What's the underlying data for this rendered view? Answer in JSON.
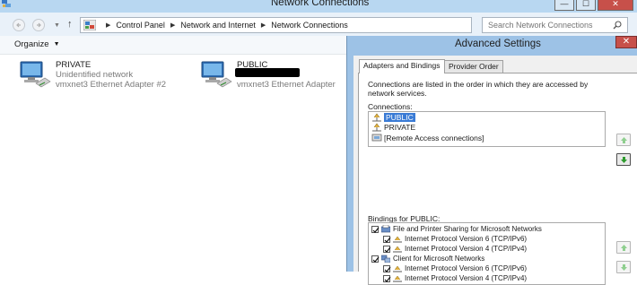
{
  "window": {
    "title": "Network Connections",
    "buttons": {
      "minimize": "—",
      "maximize": "☐",
      "close": "✕"
    }
  },
  "address": {
    "crumbs": [
      "Control Panel",
      "Network and Internet",
      "Network Connections"
    ],
    "search_placeholder": "Search Network Connections"
  },
  "toolbar": {
    "organize_label": "Organize"
  },
  "adapters": [
    {
      "name": "PRIVATE",
      "status": "Unidentified network",
      "device": "vmxnet3 Ethernet Adapter #2"
    },
    {
      "name": "PUBLIC",
      "status": "…",
      "device": "vmxnet3 Ethernet Adapter"
    }
  ],
  "dialog": {
    "title": "Advanced Settings",
    "close_glyph": "✕",
    "tabs": [
      "Adapters and Bindings",
      "Provider Order"
    ],
    "description": "Connections are listed in the order in which they are accessed by network services.",
    "connections_label": "Connections:",
    "connections": [
      "PUBLIC",
      "PRIVATE",
      "[Remote Access connections]"
    ],
    "bindings_label": "Bindings for PUBLIC:",
    "bindings": [
      "File and Printer Sharing for Microsoft Networks",
      "Internet Protocol Version 6 (TCP/IPv6)",
      "Internet Protocol Version 4 (TCP/IPv4)",
      "Client for Microsoft Networks",
      "Internet Protocol Version 6 (TCP/IPv6)",
      "Internet Protocol Version 4 (TCP/IPv4)"
    ]
  },
  "colors": {
    "titlebar": "#b8d7f1",
    "dialog_frame": "#9dc2e6",
    "selection": "#3a7bd5",
    "close_button": "#c7504a",
    "arrow_green": "#2e9b2e"
  }
}
